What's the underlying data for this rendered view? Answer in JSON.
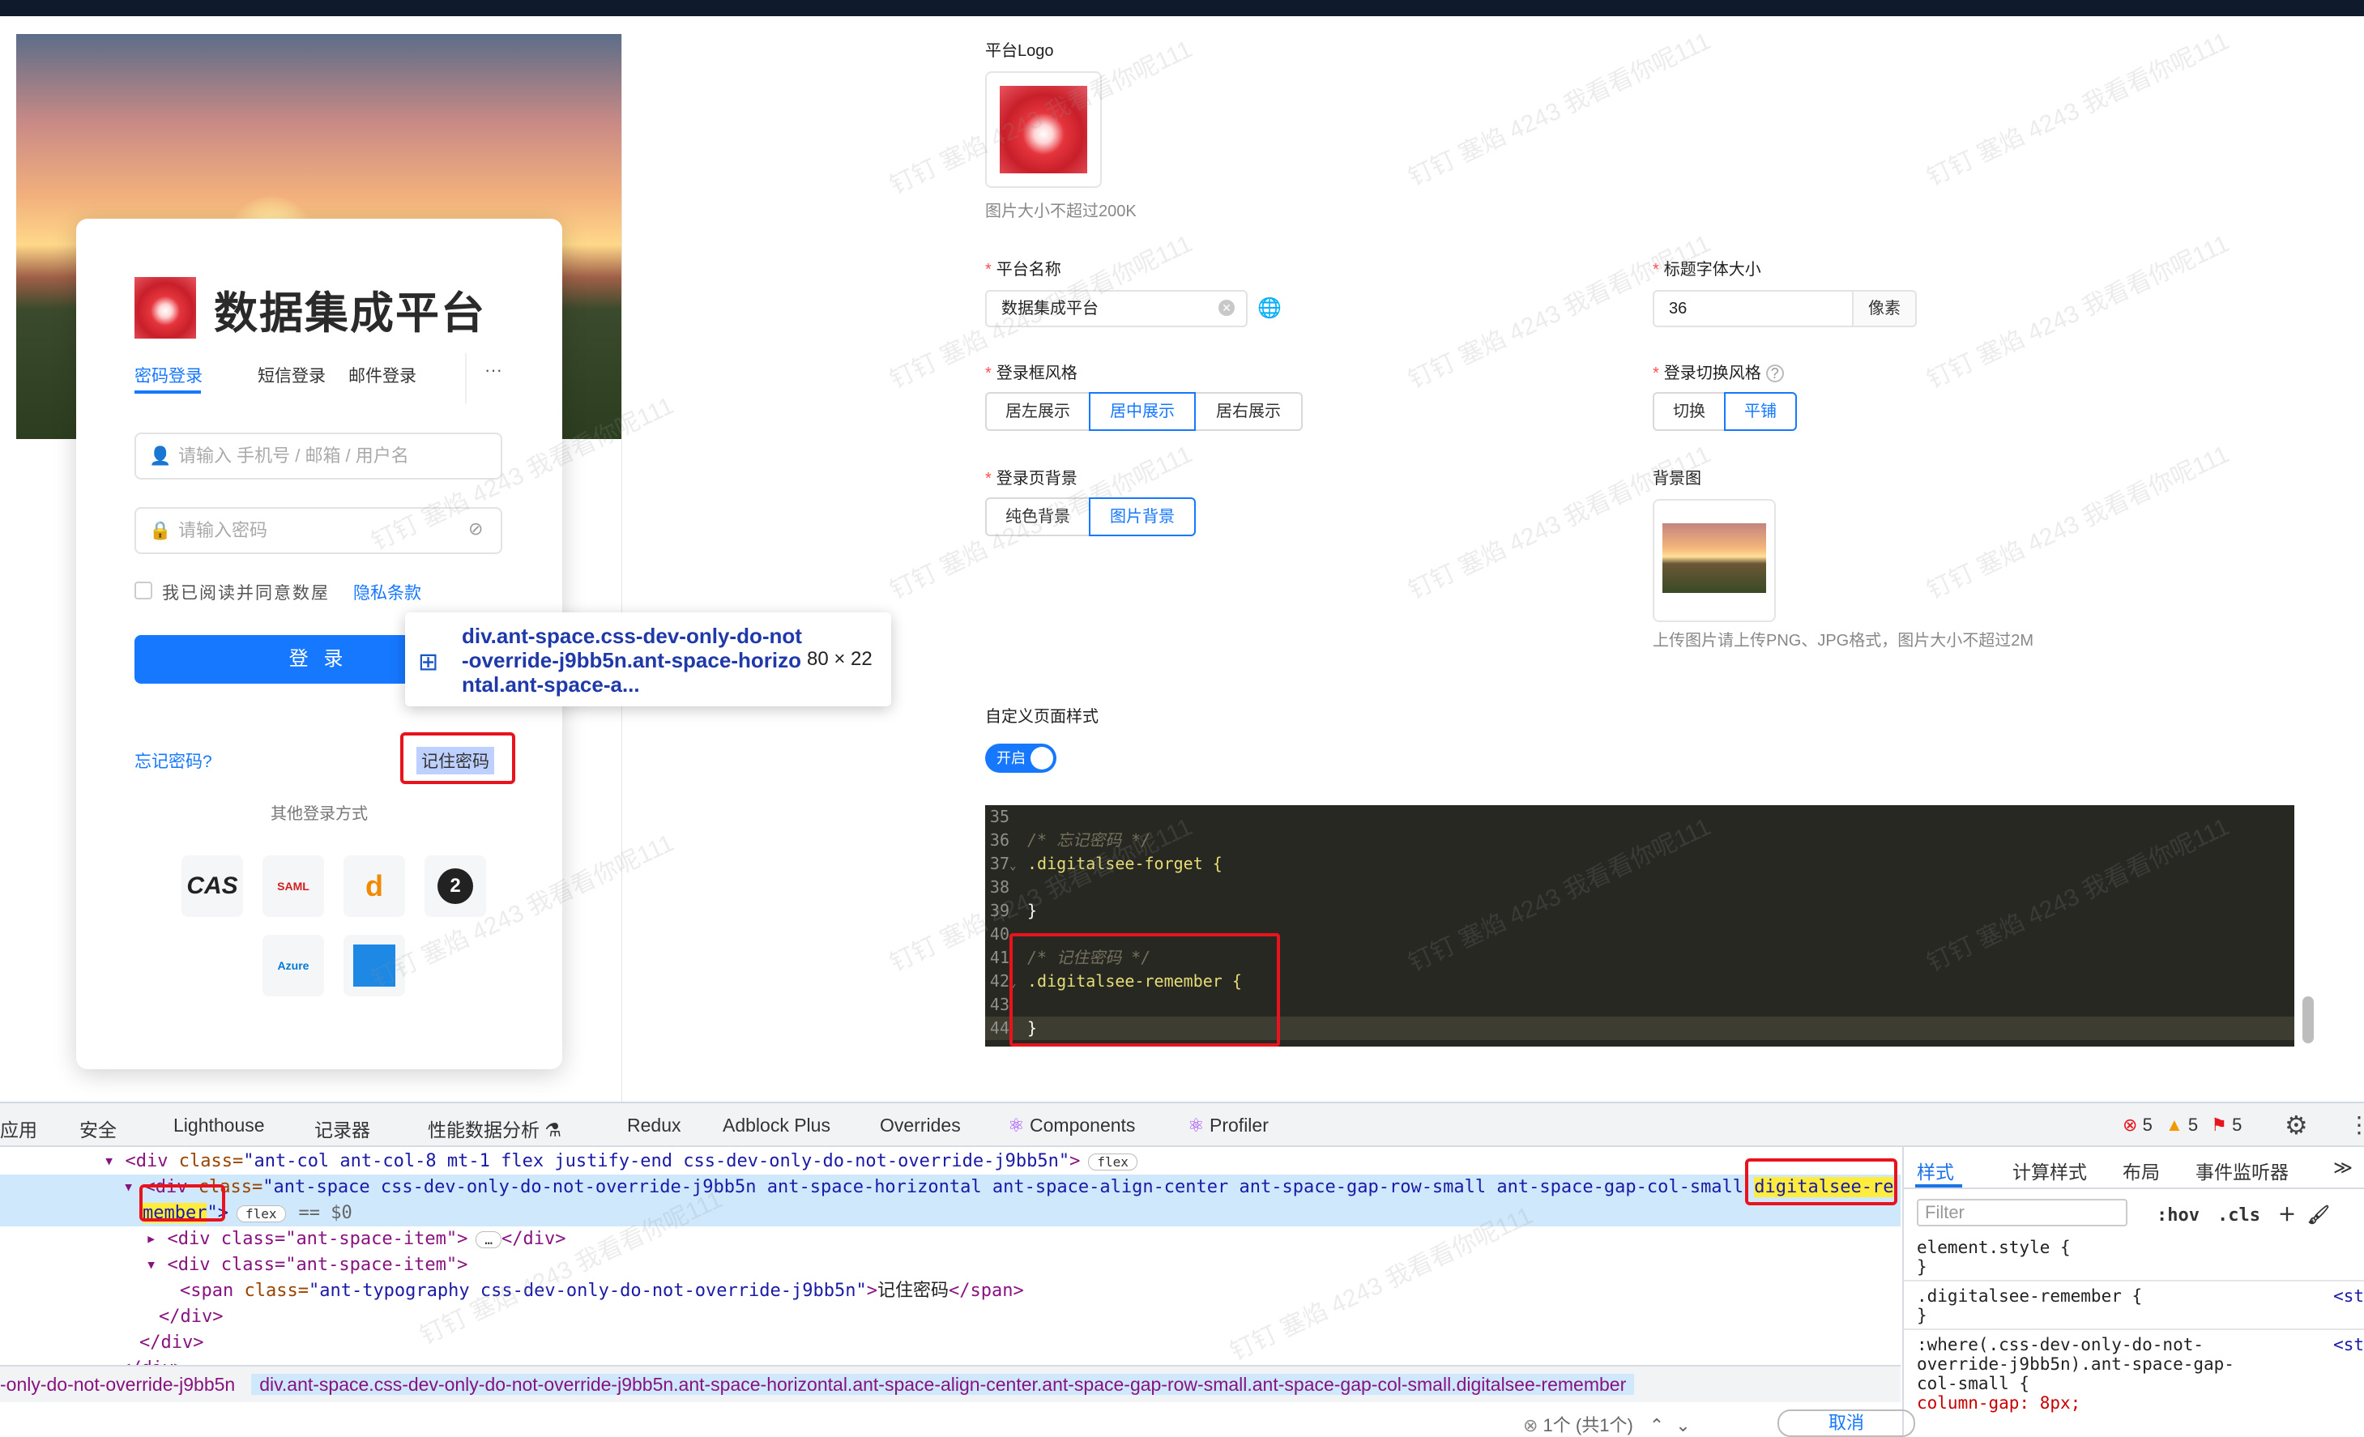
{
  "login_preview": {
    "title": "数据集成平台",
    "tabs": [
      "密码登录",
      "短信登录",
      "邮件登录",
      "···"
    ],
    "username_placeholder": "请输入 手机号 / 邮箱 / 用户名",
    "password_placeholder": "请输入密码",
    "agreement_text": "我已阅读并同意数屋",
    "privacy_link": "隐私条款",
    "login_button": "登 录",
    "forgot_password": "忘记密码?",
    "remember_password": "记住密码",
    "other_methods": "其他登录方式",
    "sso": [
      "CAS",
      "SAML",
      "d",
      "2",
      "Azure",
      ""
    ]
  },
  "tooltip": {
    "selector": "div.ant-space.css-dev-only-do-not-override-j9bb5n.ant-space-horizontal.ant-space-a...",
    "size": "80 × 22"
  },
  "settings": {
    "platform_logo_label": "平台Logo",
    "logo_hint": "图片大小不超过200K",
    "platform_name_label": "平台名称",
    "platform_name_value": "数据集成平台",
    "title_font_size_label": "标题字体大小",
    "title_font_size_value": "36",
    "title_font_size_unit": "像素",
    "login_box_style_label": "登录框风格",
    "login_box_style_options": [
      "居左展示",
      "居中展示",
      "居右展示"
    ],
    "login_box_style_selected": "居中展示",
    "login_switch_style_label": "登录切换风格",
    "login_switch_style_options": [
      "切换",
      "平铺"
    ],
    "login_switch_style_selected": "平铺",
    "login_bg_label": "登录页背景",
    "login_bg_options": [
      "纯色背景",
      "图片背景"
    ],
    "login_bg_selected": "图片背景",
    "bg_image_label": "背景图",
    "bg_image_hint": "上传图片请上传PNG、JPG格式，图片大小不超过2M",
    "custom_style_label": "自定义页面样式",
    "custom_style_toggle": "开启"
  },
  "code_editor": {
    "lines": [
      {
        "num": "35",
        "text": ""
      },
      {
        "num": "36",
        "text": "/* 忘记密码 */"
      },
      {
        "num": "37",
        "text": ".digitalsee-forget {"
      },
      {
        "num": "38",
        "text": ""
      },
      {
        "num": "39",
        "text": "}"
      },
      {
        "num": "40",
        "text": ""
      },
      {
        "num": "41",
        "text": "/* 记住密码 */"
      },
      {
        "num": "42",
        "text": ".digitalsee-remember {"
      },
      {
        "num": "43",
        "text": ""
      },
      {
        "num": "44",
        "text": "}"
      }
    ]
  },
  "devtools": {
    "tabs": [
      "应用",
      "安全",
      "Lighthouse",
      "记录器",
      "性能数据分析 ⚗",
      "Redux",
      "Adblock Plus",
      "Overrides",
      "Components",
      "Profiler"
    ],
    "errors": "5",
    "warnings": "5",
    "issues": "5",
    "dom": {
      "line1_tag": "<div ",
      "line1_attr": "class=",
      "line1_val": "\"ant-col ant-col-8 mt-1 flex justify-end css-dev-only-do-not-override-j9bb5n\"",
      "line1_end": ">",
      "line2_tag": "<div ",
      "line2_attr": "class=",
      "line2_val": "\"ant-space css-dev-only-do-not-override-j9bb5n ant-space-horizontal ant-space-align-center ant-space-gap-row-small ant-space-gap-col-small ",
      "line2_mark1": "digitalsee-re",
      "line3_mark2": "member",
      "line3_rest": "\">",
      "line3_sel": "== $0",
      "line4": "<div class=\"ant-space-item\">",
      "line4_end": "</div>",
      "line5": "<div class=\"ant-space-item\">",
      "line6_tag": "<span ",
      "line6_attr": "class=",
      "line6_val": "\"ant-typography css-dev-only-do-not-override-j9bb5n\"",
      "line6_text": "记住密码",
      "line6_end": "</span>",
      "line7": "</div>",
      "line8": "</div>",
      "line9": "</div>",
      "badge": "flex"
    },
    "breadcrumb_1": "-only-do-not-override-j9bb5n",
    "breadcrumb_2": "div.ant-space.css-dev-only-do-not-override-j9bb5n.ant-space-horizontal.ant-space-align-center.ant-space-gap-row-small.ant-space-gap-col-small.digitalsee-remember",
    "search_count": "1个 (共1个)",
    "search_cancel": "取消",
    "styles_tabs": [
      "样式",
      "计算样式",
      "布局",
      "事件监听器",
      "≫"
    ],
    "filter_placeholder": "Filter",
    "hov": ":hov",
    "cls": ".cls",
    "rules": [
      "element.style {",
      "}",
      ".digitalsee-remember {",
      "}",
      ":where(.css-dev-only-do-not-",
      "override-j9bb5n).ant-space-gap-",
      "col-small {",
      "  column-gap: 8px;"
    ],
    "rule_source": "<st"
  },
  "watermark": "钉钉 塞焰 4243 我看看你呢111"
}
